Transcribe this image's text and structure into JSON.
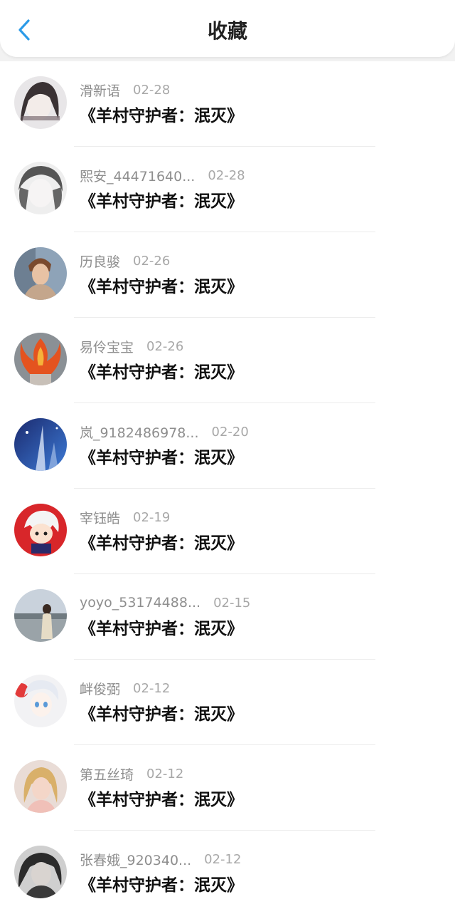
{
  "header": {
    "title": "收藏",
    "back_icon": "chevron-left-icon",
    "accent": "#2c9be8"
  },
  "items": [
    {
      "name": "滑新语",
      "date": "02-28",
      "title": "《羊村守护者：泯灭》"
    },
    {
      "name": "熙安_44471640...",
      "date": "02-28",
      "title": "《羊村守护者：泯灭》"
    },
    {
      "name": "历良骏",
      "date": "02-26",
      "title": "《羊村守护者：泯灭》"
    },
    {
      "name": "易伶宝宝",
      "date": "02-26",
      "title": "《羊村守护者：泯灭》"
    },
    {
      "name": "岚_9182486978...",
      "date": "02-20",
      "title": "《羊村守护者：泯灭》"
    },
    {
      "name": "宰钰皓",
      "date": "02-19",
      "title": "《羊村守护者：泯灭》"
    },
    {
      "name": "yoyo_53174488...",
      "date": "02-15",
      "title": "《羊村守护者：泯灭》"
    },
    {
      "name": "衅俊弼",
      "date": "02-12",
      "title": "《羊村守护者：泯灭》"
    },
    {
      "name": "第五丝琦",
      "date": "02-12",
      "title": "《羊村守护者：泯灭》"
    },
    {
      "name": "张春娥_920340...",
      "date": "02-12",
      "title": "《羊村守护者：泯灭》"
    }
  ]
}
